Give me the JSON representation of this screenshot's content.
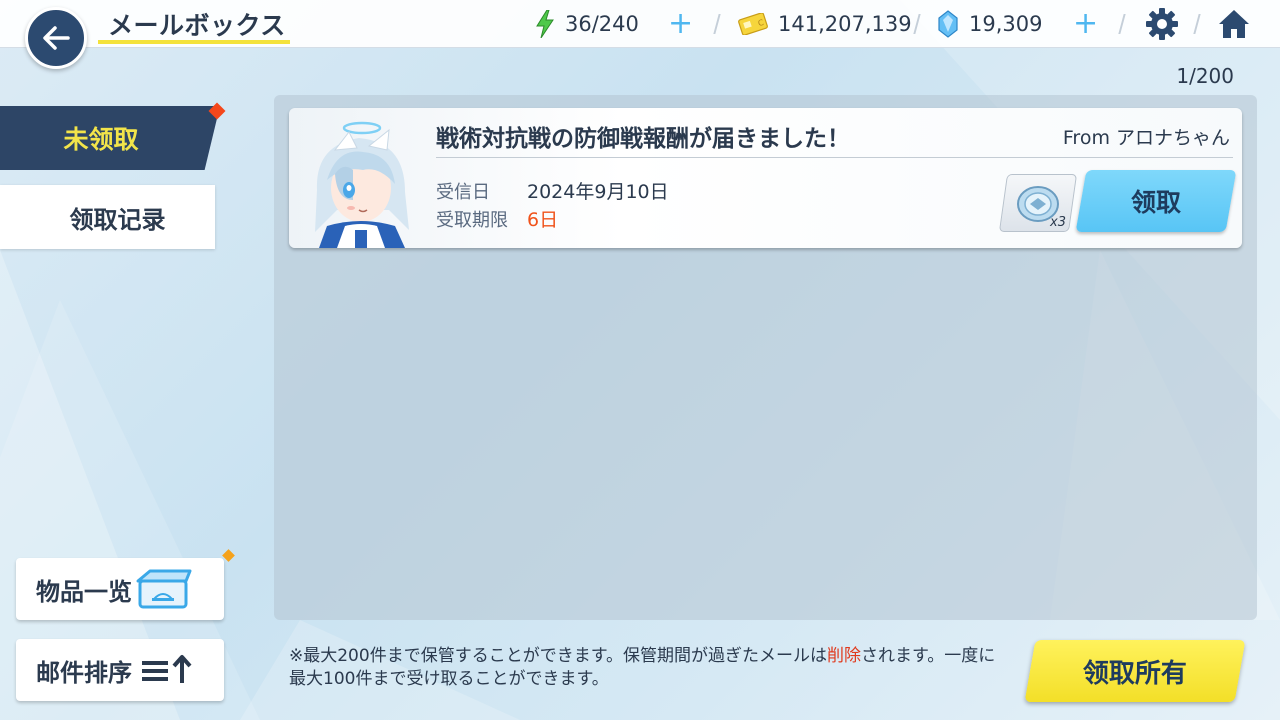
{
  "header": {
    "title": "メールボックス",
    "ap": "36/240",
    "credits": "141,207,139",
    "pyroxene": "19,309"
  },
  "mailbox": {
    "counter": "1/200"
  },
  "tabs": {
    "unclaimed": "未领取",
    "history": "领取记录"
  },
  "mail": {
    "title": "戦術対抗戦の防御戦報酬が届きました！",
    "from": "From アロナちゃん",
    "received_label": "受信日",
    "received_value": "2024年9月10日",
    "expiry_label": "受取期限",
    "expiry_value": "6日",
    "item_qty": "x3",
    "claim_label": "领取"
  },
  "sidebar": {
    "items_list": "物品一览",
    "sort": "邮件排序"
  },
  "notice": {
    "part1": "※最大200件まで保管することができます。保管期間が過ぎたメールは",
    "highlight": "削除",
    "part2": "されます。一度に最大100件まで受け取ることができます。"
  },
  "footer": {
    "claim_all": "领取所有"
  },
  "colors": {
    "accent_yellow": "#f3df28",
    "accent_blue": "#58c5f5",
    "navy": "#2d4566",
    "warning": "#f0531b"
  }
}
